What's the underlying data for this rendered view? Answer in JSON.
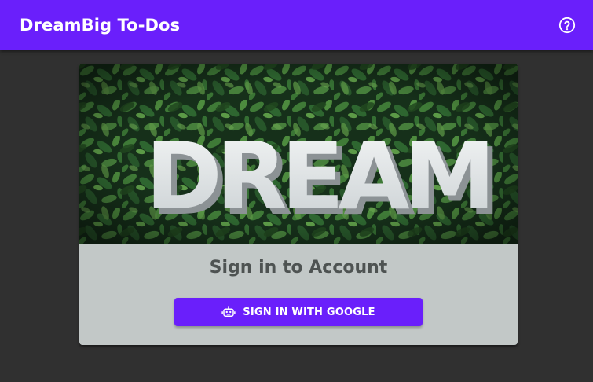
{
  "app": {
    "title": "DreamBig To-Dos",
    "help_icon": "help-circle-icon"
  },
  "card": {
    "hero_image_alt": "DREAM",
    "title": "Sign in to Account",
    "signin_label": "SIGN IN WITH GOOGLE",
    "signin_icon": "robot-icon"
  },
  "colors": {
    "accent": "#6a1ffb",
    "background": "#303030",
    "card": "#c2c8c7"
  }
}
